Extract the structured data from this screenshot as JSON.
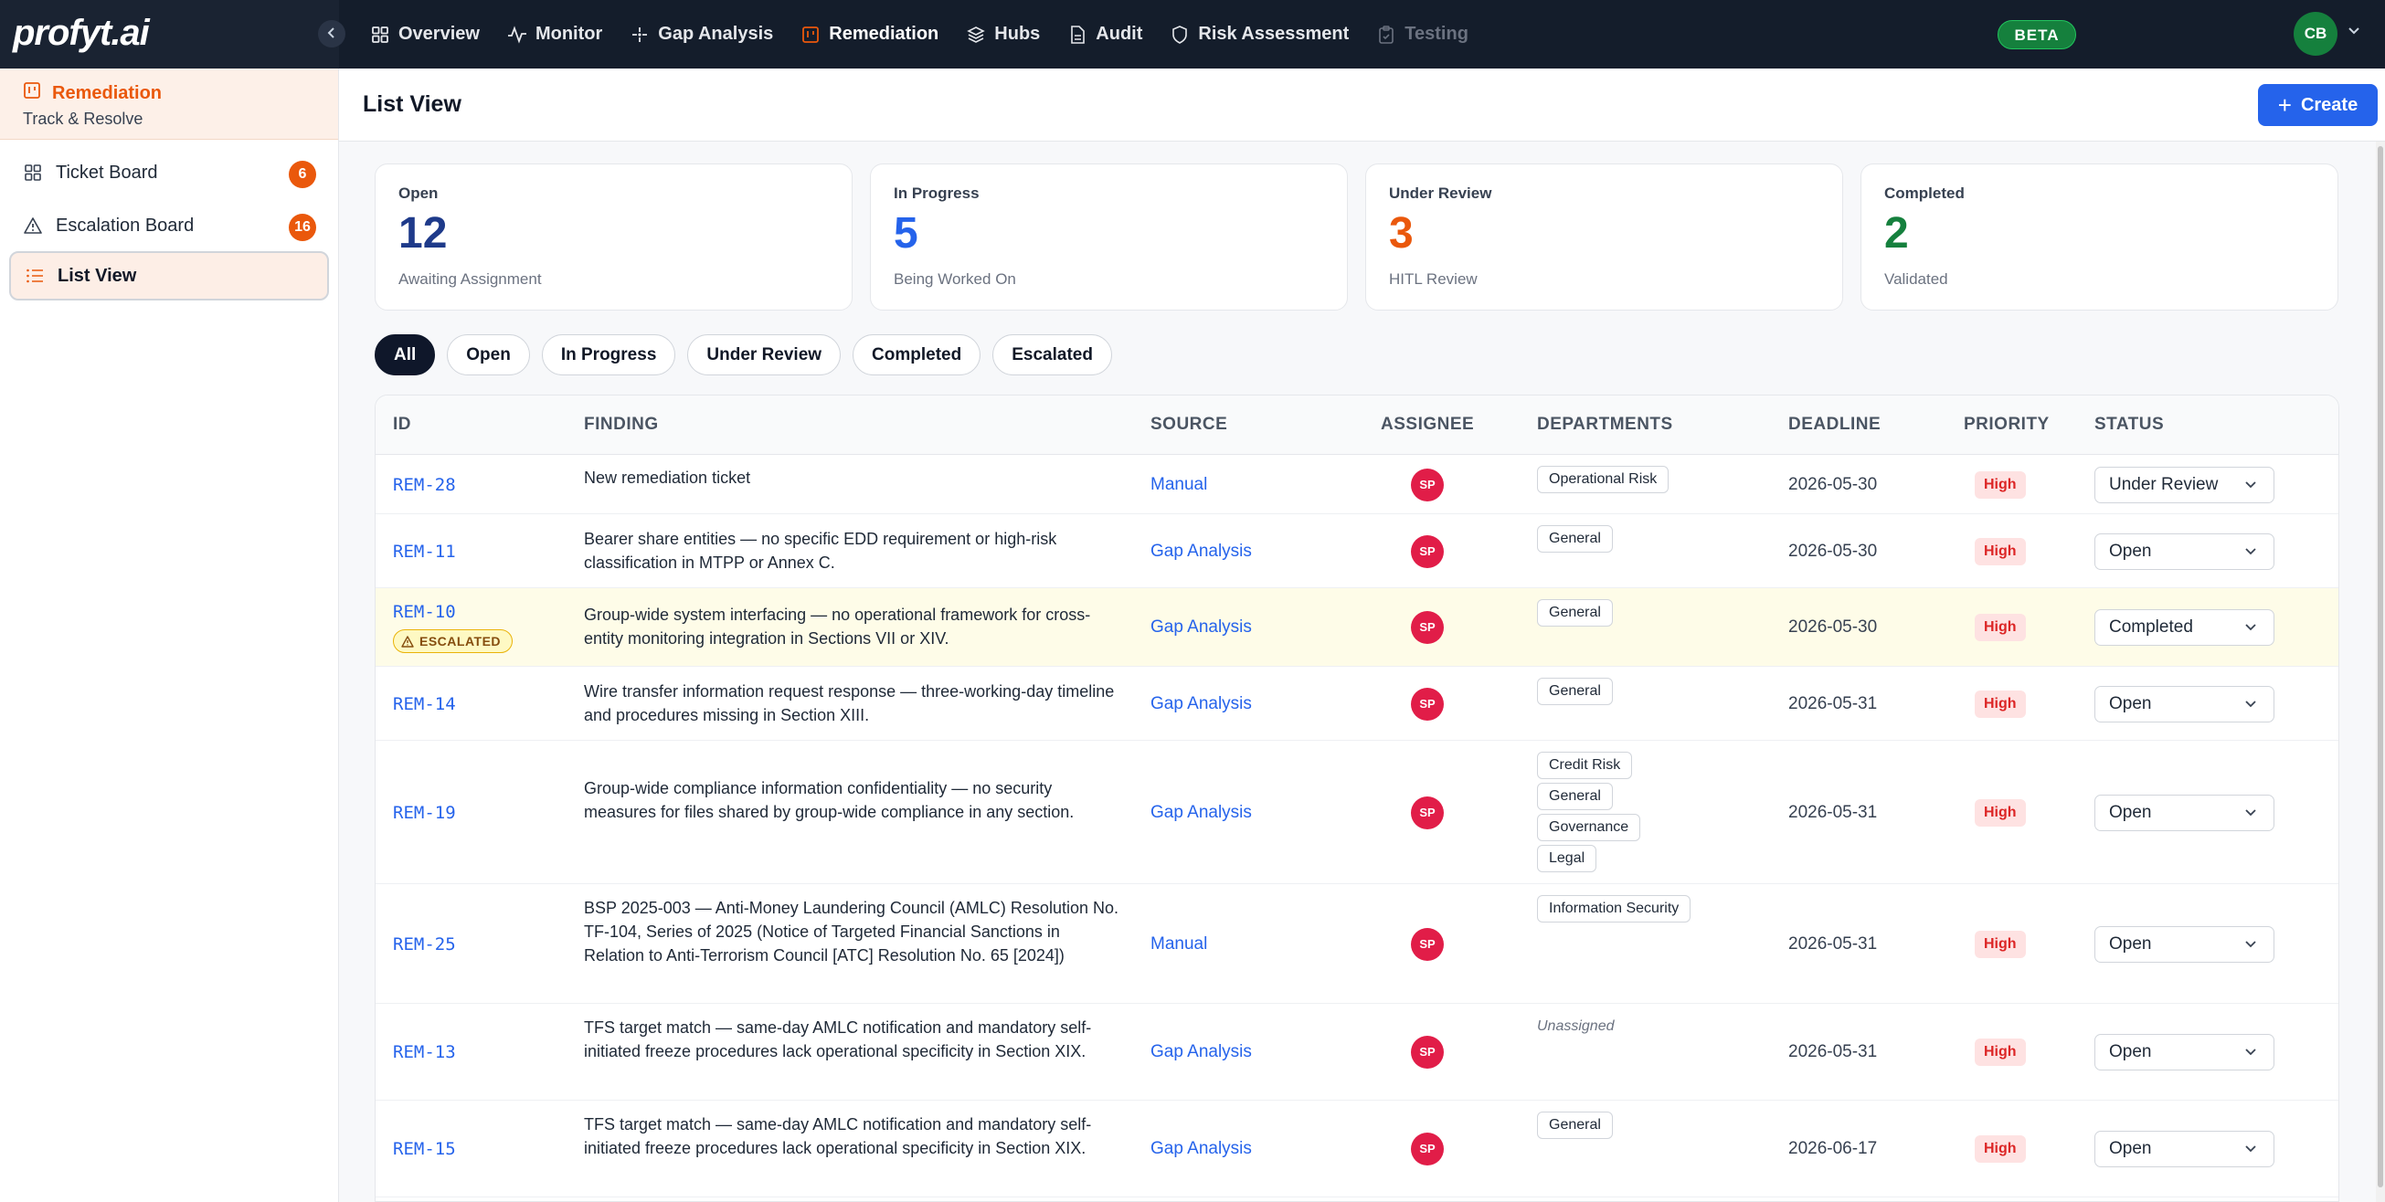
{
  "app": {
    "logo": "profyt.ai",
    "beta": "BETA",
    "user_initials": "CB"
  },
  "nav": {
    "items": [
      {
        "label": "Overview",
        "icon": "grid-icon"
      },
      {
        "label": "Monitor",
        "icon": "pulse-icon"
      },
      {
        "label": "Gap Analysis",
        "icon": "sparkle-icon"
      },
      {
        "label": "Remediation",
        "icon": "kanban-icon"
      },
      {
        "label": "Hubs",
        "icon": "layers-icon"
      },
      {
        "label": "Audit",
        "icon": "document-icon"
      },
      {
        "label": "Risk Assessment",
        "icon": "shield-icon"
      },
      {
        "label": "Testing",
        "icon": "clipboard-icon"
      }
    ],
    "active": "Remediation",
    "disabled": "Testing"
  },
  "sidebar": {
    "title": "Remediation",
    "subtitle": "Track & Resolve",
    "items": [
      {
        "label": "Ticket Board",
        "badge": "6",
        "icon": "grid-icon"
      },
      {
        "label": "Escalation Board",
        "badge": "16",
        "icon": "warning-icon"
      },
      {
        "label": "List View",
        "badge": "",
        "icon": "list-icon"
      }
    ]
  },
  "main": {
    "title": "List View",
    "create_label": "Create"
  },
  "stats": [
    {
      "label": "Open",
      "value": "12",
      "sub": "Awaiting Assignment",
      "color": "#1e3a8a"
    },
    {
      "label": "In Progress",
      "value": "5",
      "sub": "Being Worked On",
      "color": "#2563eb"
    },
    {
      "label": "Under Review",
      "value": "3",
      "sub": "HITL Review",
      "color": "#ea580c"
    },
    {
      "label": "Completed",
      "value": "2",
      "sub": "Validated",
      "color": "#15803d"
    }
  ],
  "filters": [
    "All",
    "Open",
    "In Progress",
    "Under Review",
    "Completed",
    "Escalated"
  ],
  "table": {
    "headers": [
      "ID",
      "FINDING",
      "SOURCE",
      "ASSIGNEE",
      "DEPARTMENTS",
      "DEADLINE",
      "PRIORITY",
      "STATUS"
    ],
    "escalated_label": "ESCALATED",
    "unassigned_label": "Unassigned",
    "rows": [
      {
        "id": "REM-28",
        "finding": "New remediation ticket",
        "source": "Manual",
        "assignee": "SP",
        "departments": [
          "Operational Risk"
        ],
        "deadline": "2026-05-30",
        "priority": "High",
        "status": "Under Review",
        "escalated": false
      },
      {
        "id": "REM-11",
        "finding": "Bearer share entities — no specific EDD requirement or high-risk classification in MTPP or Annex C.",
        "source": "Gap Analysis",
        "assignee": "SP",
        "departments": [
          "General"
        ],
        "deadline": "2026-05-30",
        "priority": "High",
        "status": "Open",
        "escalated": false
      },
      {
        "id": "REM-10",
        "finding": "Group-wide system interfacing — no operational framework for cross-entity monitoring integration in Sections VII or XIV.",
        "source": "Gap Analysis",
        "assignee": "SP",
        "departments": [
          "General"
        ],
        "deadline": "2026-05-30",
        "priority": "High",
        "status": "Completed",
        "escalated": true
      },
      {
        "id": "REM-14",
        "finding": "Wire transfer information request response — three-working-day timeline and procedures missing in Section XIII.",
        "source": "Gap Analysis",
        "assignee": "SP",
        "departments": [
          "General"
        ],
        "deadline": "2026-05-31",
        "priority": "High",
        "status": "Open",
        "escalated": false
      },
      {
        "id": "REM-19",
        "finding": "Group-wide compliance information confidentiality — no security measures for files shared by group-wide compliance in any section.",
        "source": "Gap Analysis",
        "assignee": "SP",
        "departments": [
          "Credit Risk",
          "General",
          "Governance",
          "Legal"
        ],
        "deadline": "2026-05-31",
        "priority": "High",
        "status": "Open",
        "escalated": false
      },
      {
        "id": "REM-25",
        "finding": "BSP 2025-003 — Anti-Money Laundering Council (AMLC) Resolution No. TF-104, Series of 2025 (Notice of Targeted Financial Sanctions in Relation to Anti-Terrorism Council [ATC] Resolution No. 65 [2024])",
        "source": "Manual",
        "assignee": "SP",
        "departments": [
          "Information Security"
        ],
        "deadline": "2026-05-31",
        "priority": "High",
        "status": "Open",
        "escalated": false
      },
      {
        "id": "REM-13",
        "finding": "TFS target match — same-day AMLC notification and mandatory self-initiated freeze procedures lack operational specificity in Section XIX.",
        "source": "Gap Analysis",
        "assignee": "SP",
        "departments": [],
        "deadline": "2026-05-31",
        "priority": "High",
        "status": "Open",
        "escalated": false
      },
      {
        "id": "REM-15",
        "finding": "TFS target match — same-day AMLC notification and mandatory self-initiated freeze procedures lack operational specificity in Section XIX.",
        "source": "Gap Analysis",
        "assignee": "SP",
        "departments": [
          "General"
        ],
        "deadline": "2026-06-17",
        "priority": "High",
        "status": "Open",
        "escalated": false
      }
    ]
  }
}
